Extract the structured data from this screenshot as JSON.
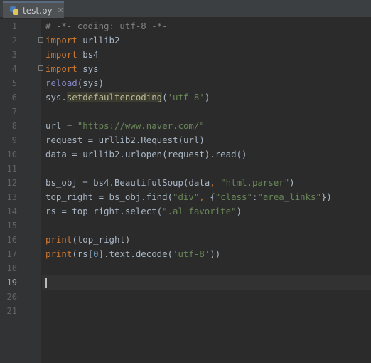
{
  "tab": {
    "filename": "test.py",
    "close_glyph": "✕",
    "icon": "python-file-icon"
  },
  "current_line": 19,
  "lines": [
    {
      "n": "1",
      "tokens": [
        {
          "t": "# -*- coding: utf-8 -*-",
          "c": "cmt"
        }
      ]
    },
    {
      "n": "2",
      "fold": true,
      "tokens": [
        {
          "t": "import",
          "c": "kw"
        },
        {
          "t": " urllib2",
          "c": ""
        }
      ]
    },
    {
      "n": "3",
      "tokens": [
        {
          "t": "import",
          "c": "kw"
        },
        {
          "t": " bs4",
          "c": ""
        }
      ]
    },
    {
      "n": "4",
      "fold": true,
      "tokens": [
        {
          "t": "import",
          "c": "kw"
        },
        {
          "t": " sys",
          "c": ""
        }
      ]
    },
    {
      "n": "5",
      "tokens": [
        {
          "t": "reload",
          "c": "bi"
        },
        {
          "t": "(sys)",
          "c": ""
        }
      ]
    },
    {
      "n": "6",
      "tokens": [
        {
          "t": "sys.",
          "c": ""
        },
        {
          "t": "setdefaultencoding",
          "c": "hl"
        },
        {
          "t": "(",
          "c": ""
        },
        {
          "t": "'utf-8'",
          "c": "str"
        },
        {
          "t": ")",
          "c": ""
        }
      ]
    },
    {
      "n": "7",
      "tokens": []
    },
    {
      "n": "8",
      "tokens": [
        {
          "t": "url = ",
          "c": ""
        },
        {
          "t": "\"",
          "c": "str"
        },
        {
          "t": "https://www.naver.com/",
          "c": "url"
        },
        {
          "t": "\"",
          "c": "str"
        }
      ]
    },
    {
      "n": "9",
      "tokens": [
        {
          "t": "request = urllib2.Request(url)",
          "c": ""
        }
      ]
    },
    {
      "n": "10",
      "tokens": [
        {
          "t": "data = urllib2.urlopen(request).read()",
          "c": ""
        }
      ]
    },
    {
      "n": "11",
      "tokens": []
    },
    {
      "n": "12",
      "tokens": [
        {
          "t": "bs_obj = bs4.BeautifulSoup(data",
          "c": ""
        },
        {
          "t": ", ",
          "c": "kw"
        },
        {
          "t": "\"html.parser\"",
          "c": "str"
        },
        {
          "t": ")",
          "c": ""
        }
      ]
    },
    {
      "n": "13",
      "tokens": [
        {
          "t": "top_right = bs_obj.find(",
          "c": ""
        },
        {
          "t": "\"div\"",
          "c": "str"
        },
        {
          "t": ", ",
          "c": "kw"
        },
        {
          "t": "{",
          "c": ""
        },
        {
          "t": "\"class\"",
          "c": "str"
        },
        {
          "t": ":",
          "c": ""
        },
        {
          "t": "\"area_links\"",
          "c": "str"
        },
        {
          "t": "})",
          "c": ""
        }
      ]
    },
    {
      "n": "14",
      "tokens": [
        {
          "t": "rs = top_right.select(",
          "c": ""
        },
        {
          "t": "\".al_favorite\"",
          "c": "str"
        },
        {
          "t": ")",
          "c": ""
        }
      ]
    },
    {
      "n": "15",
      "tokens": []
    },
    {
      "n": "16",
      "tokens": [
        {
          "t": "print",
          "c": "kw"
        },
        {
          "t": "(top_right)",
          "c": ""
        }
      ]
    },
    {
      "n": "17",
      "tokens": [
        {
          "t": "print",
          "c": "kw"
        },
        {
          "t": "(rs[",
          "c": ""
        },
        {
          "t": "0",
          "c": "num"
        },
        {
          "t": "].text.decode(",
          "c": ""
        },
        {
          "t": "'utf-8'",
          "c": "str"
        },
        {
          "t": "))",
          "c": ""
        }
      ]
    },
    {
      "n": "18",
      "tokens": []
    },
    {
      "n": "19",
      "tokens": []
    },
    {
      "n": "20",
      "tokens": []
    },
    {
      "n": "21",
      "tokens": []
    }
  ],
  "colors": {
    "background": "#2b2b2b",
    "gutter": "#313335",
    "keyword": "#cc7832",
    "string": "#6a8759",
    "number": "#6897bb",
    "comment": "#808080",
    "builtin": "#8888c6",
    "text": "#a9b7c6"
  }
}
